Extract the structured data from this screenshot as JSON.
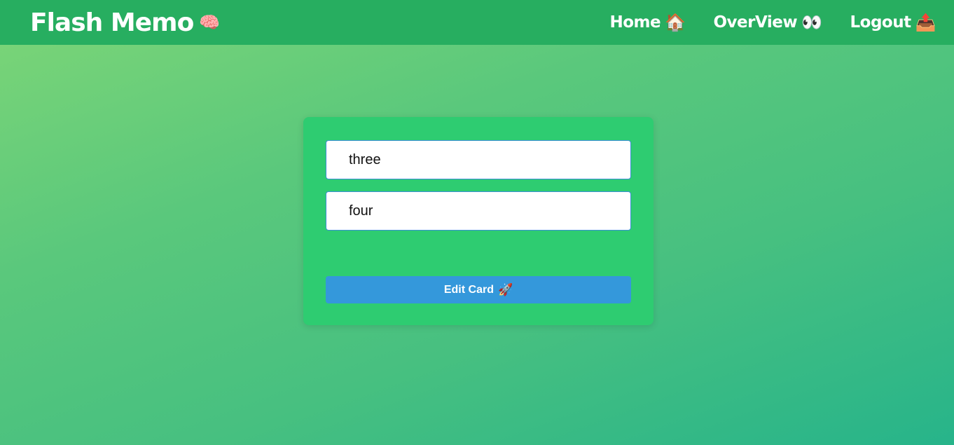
{
  "navbar": {
    "brand": {
      "label": "Flash Memo",
      "icon": "🧠"
    },
    "links": [
      {
        "label": "Home",
        "icon": "🏠"
      },
      {
        "label": "OverView",
        "icon": "👀"
      },
      {
        "label": "Logout",
        "icon": "📤"
      }
    ]
  },
  "form": {
    "front_value": "three",
    "back_value": "four",
    "submit": {
      "label": "Edit Card",
      "icon": "🚀"
    }
  },
  "colors": {
    "navbar": "#27ae60",
    "card": "#2ecc71",
    "button": "#3498db"
  }
}
